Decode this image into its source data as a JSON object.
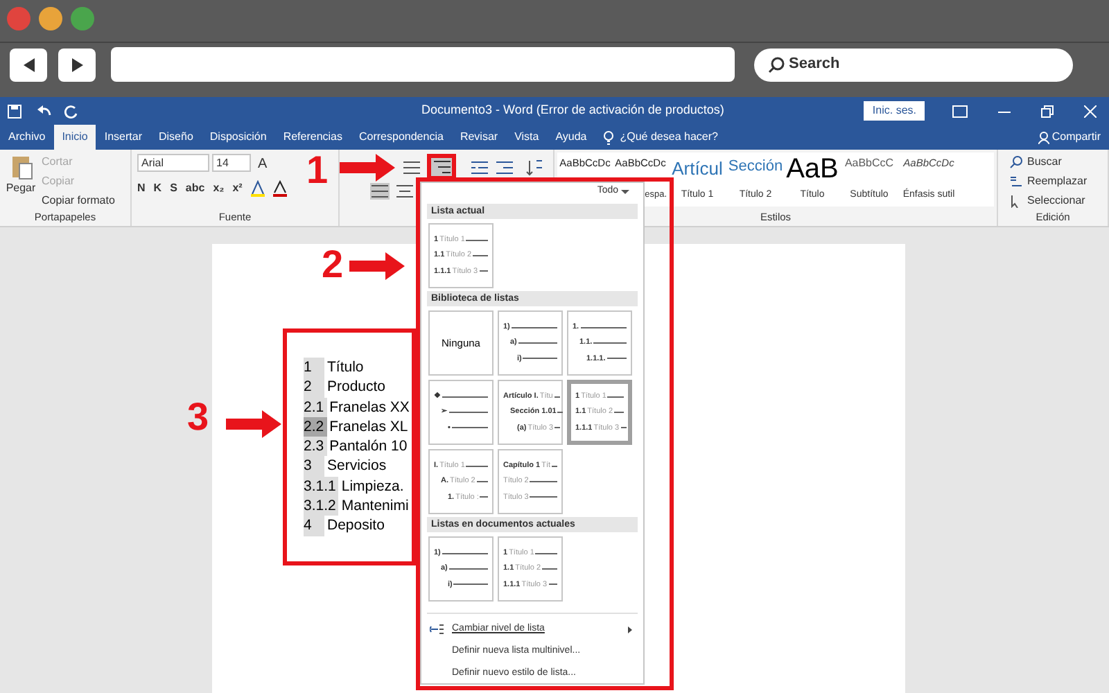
{
  "browser": {
    "search_placeholder": "Search"
  },
  "word": {
    "title": "Documento3  -  Word (Error de activación de productos)",
    "signin": "Inic. ses.",
    "tabs": [
      {
        "label": "Archivo",
        "selected": false
      },
      {
        "label": "Inicio",
        "selected": true
      },
      {
        "label": "Insertar",
        "selected": false
      },
      {
        "label": "Diseño",
        "selected": false
      },
      {
        "label": "Disposición",
        "selected": false
      },
      {
        "label": "Referencias",
        "selected": false
      },
      {
        "label": "Correspondencia",
        "selected": false
      },
      {
        "label": "Revisar",
        "selected": false
      },
      {
        "label": "Vista",
        "selected": false
      },
      {
        "label": "Ayuda",
        "selected": false
      }
    ],
    "tell_me": "¿Qué desea hacer?",
    "share": "Compartir",
    "clipboard": {
      "paste": "Pegar",
      "items": [
        {
          "label": "Cortar",
          "disabled": true
        },
        {
          "label": "Copiar",
          "disabled": true
        },
        {
          "label": "Copiar formato",
          "disabled": false
        }
      ],
      "group": "Portapapeles"
    },
    "font": {
      "name": "Arial",
      "size": "14",
      "grow": "A",
      "format_buttons": [
        "N",
        "K",
        "S",
        "abc",
        "x₂",
        "x²"
      ],
      "group": "Fuente"
    },
    "styles": {
      "items": [
        {
          "preview": "AaBbCcDc"
        },
        {
          "preview": "AaBbCcDc",
          "label": "espa."
        },
        {
          "preview": "Artícul",
          "label": "Título 1"
        },
        {
          "preview": "Sección",
          "label": "Título 2"
        },
        {
          "preview": "AaB",
          "label": "Título"
        },
        {
          "preview": "AaBbCcC",
          "label": "Subtítulo"
        },
        {
          "preview": "AaBbCcDc",
          "label": "Énfasis sutil"
        }
      ],
      "group": "Estilos"
    },
    "editing": {
      "items": [
        "Buscar",
        "Reemplazar",
        "Seleccionar"
      ],
      "group": "Edición"
    }
  },
  "document": {
    "rows": [
      {
        "number": "1",
        "text": "Título",
        "selected": false
      },
      {
        "number": "2",
        "text": "Producto",
        "selected": false
      },
      {
        "number": "2.1",
        "text": "Franelas XX",
        "selected": false
      },
      {
        "number": "2.2",
        "text": "Franelas XL",
        "selected": true
      },
      {
        "number": "2.3",
        "text": "Pantalón 10",
        "selected": false
      },
      {
        "number": "3",
        "text": "Servicios",
        "selected": false
      },
      {
        "number": "3.1.1",
        "text": "Limpieza.",
        "selected": false
      },
      {
        "number": "3.1.2",
        "text": "Mantenimi",
        "selected": false
      },
      {
        "number": "4",
        "text": "Deposito",
        "selected": false
      }
    ]
  },
  "dropdown": {
    "filter": "Todo",
    "sections": [
      {
        "title": "Lista actual",
        "tiles": [
          {
            "kind": "flat",
            "selected": false,
            "rows": [
              {
                "num": "1",
                "label": "Título 1"
              },
              {
                "num": "1.1",
                "label": "Título 2"
              },
              {
                "num": "1.1.1",
                "label": "Título 3"
              }
            ]
          }
        ]
      },
      {
        "title": "Biblioteca de listas",
        "tiles": [
          {
            "kind": "none",
            "selected": false,
            "text": "Ninguna"
          },
          {
            "kind": "stepped",
            "selected": false,
            "rows": [
              {
                "num": "1)"
              },
              {
                "num": "a)"
              },
              {
                "num": "i)"
              }
            ]
          },
          {
            "kind": "stepped",
            "selected": false,
            "rows": [
              {
                "num": "1."
              },
              {
                "num": "1.1."
              },
              {
                "num": "1.1.1."
              }
            ]
          },
          {
            "kind": "stepped",
            "selected": false,
            "rows": [
              {
                "num": "❖"
              },
              {
                "num": "➢"
              },
              {
                "num": "•"
              }
            ]
          },
          {
            "kind": "stepped",
            "selected": false,
            "rows": [
              {
                "num": "Artículo I.",
                "label": "Títu"
              },
              {
                "num": "Sección 1.01"
              },
              {
                "num": "(a)",
                "label": "Título 3"
              }
            ]
          },
          {
            "kind": "flat",
            "selected": true,
            "rows": [
              {
                "num": "1",
                "label": "Título 1"
              },
              {
                "num": "1.1",
                "label": "Título 2"
              },
              {
                "num": "1.1.1",
                "label": "Título 3"
              }
            ]
          },
          {
            "kind": "stepped",
            "selected": false,
            "rows": [
              {
                "num": "I.",
                "label": "Título 1"
              },
              {
                "num": "A.",
                "label": "Título 2"
              },
              {
                "num": "1.",
                "label": "Título :"
              }
            ]
          },
          {
            "kind": "flat",
            "selected": false,
            "rows": [
              {
                "num": "Capítulo 1",
                "label": "Tít"
              },
              {
                "label": "Título 2"
              },
              {
                "label": "Título 3"
              }
            ]
          }
        ]
      },
      {
        "title": "Listas en documentos actuales",
        "tiles": [
          {
            "kind": "stepped",
            "selected": false,
            "rows": [
              {
                "num": "1)"
              },
              {
                "num": "a)"
              },
              {
                "num": "i)"
              }
            ]
          },
          {
            "kind": "flat",
            "selected": false,
            "rows": [
              {
                "num": "1",
                "label": "Título 1"
              },
              {
                "num": "1.1",
                "label": "Título 2"
              },
              {
                "num": "1.1.1",
                "label": "Título 3"
              }
            ]
          }
        ]
      }
    ],
    "menu": [
      {
        "label": "Cambiar nivel de lista",
        "submenu": true
      },
      {
        "label": "Definir nueva lista multinivel...",
        "submenu": false
      },
      {
        "label": "Definir nuevo estilo de lista...",
        "submenu": false
      }
    ]
  },
  "annotations": [
    "1",
    "2",
    "3"
  ]
}
